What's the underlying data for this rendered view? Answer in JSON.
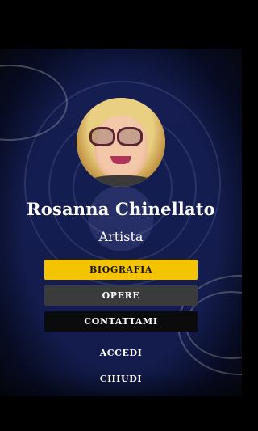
{
  "profile": {
    "name": "Rosanna Chinellato",
    "role": "Artista"
  },
  "menu": {
    "biografia": "BIOGRAFIA",
    "opere": "OPERE",
    "contattami": "CONTATTAMI"
  },
  "links": {
    "accedi": "ACCEDI",
    "chiudi": "CHIUDI"
  },
  "colors": {
    "accent": "#f5c400",
    "secondary_button": "#3b3b3b",
    "background": "#000000",
    "rose": "#1b2560"
  }
}
